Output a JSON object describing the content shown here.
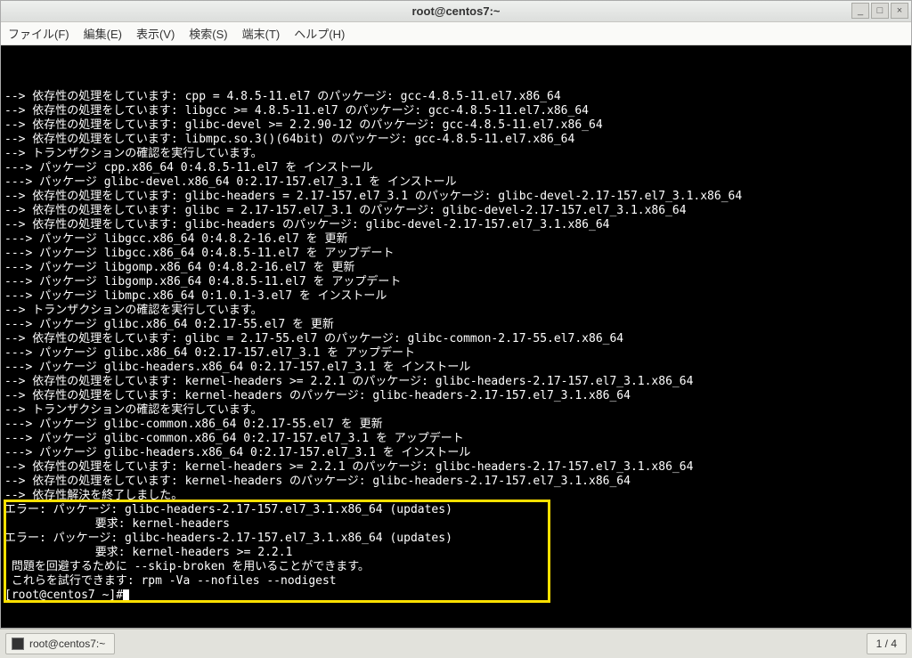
{
  "window": {
    "title": "root@centos7:~"
  },
  "menu": {
    "file": "ファイル(F)",
    "edit": "編集(E)",
    "view": "表示(V)",
    "search": "検索(S)",
    "terminal": "端末(T)",
    "help": "ヘルプ(H)"
  },
  "titlebar_buttons": {
    "min": "_",
    "max": "□",
    "close": "×"
  },
  "terminal_lines": [
    "--> 依存性の処理をしています: cpp = 4.8.5-11.el7 のパッケージ: gcc-4.8.5-11.el7.x86_64",
    "--> 依存性の処理をしています: libgcc >= 4.8.5-11.el7 のパッケージ: gcc-4.8.5-11.el7.x86_64",
    "--> 依存性の処理をしています: glibc-devel >= 2.2.90-12 のパッケージ: gcc-4.8.5-11.el7.x86_64",
    "--> 依存性の処理をしています: libmpc.so.3()(64bit) のパッケージ: gcc-4.8.5-11.el7.x86_64",
    "--> トランザクションの確認を実行しています。",
    "---> パッケージ cpp.x86_64 0:4.8.5-11.el7 を インストール",
    "---> パッケージ glibc-devel.x86_64 0:2.17-157.el7_3.1 を インストール",
    "--> 依存性の処理をしています: glibc-headers = 2.17-157.el7_3.1 のパッケージ: glibc-devel-2.17-157.el7_3.1.x86_64",
    "--> 依存性の処理をしています: glibc = 2.17-157.el7_3.1 のパッケージ: glibc-devel-2.17-157.el7_3.1.x86_64",
    "--> 依存性の処理をしています: glibc-headers のパッケージ: glibc-devel-2.17-157.el7_3.1.x86_64",
    "---> パッケージ libgcc.x86_64 0:4.8.2-16.el7 を 更新",
    "---> パッケージ libgcc.x86_64 0:4.8.5-11.el7 を アップデート",
    "---> パッケージ libgomp.x86_64 0:4.8.2-16.el7 を 更新",
    "---> パッケージ libgomp.x86_64 0:4.8.5-11.el7 を アップデート",
    "---> パッケージ libmpc.x86_64 0:1.0.1-3.el7 を インストール",
    "--> トランザクションの確認を実行しています。",
    "---> パッケージ glibc.x86_64 0:2.17-55.el7 を 更新",
    "--> 依存性の処理をしています: glibc = 2.17-55.el7 のパッケージ: glibc-common-2.17-55.el7.x86_64",
    "---> パッケージ glibc.x86_64 0:2.17-157.el7_3.1 を アップデート",
    "---> パッケージ glibc-headers.x86_64 0:2.17-157.el7_3.1 を インストール",
    "--> 依存性の処理をしています: kernel-headers >= 2.2.1 のパッケージ: glibc-headers-2.17-157.el7_3.1.x86_64",
    "--> 依存性の処理をしています: kernel-headers のパッケージ: glibc-headers-2.17-157.el7_3.1.x86_64",
    "--> トランザクションの確認を実行しています。",
    "---> パッケージ glibc-common.x86_64 0:2.17-55.el7 を 更新",
    "---> パッケージ glibc-common.x86_64 0:2.17-157.el7_3.1 を アップデート",
    "---> パッケージ glibc-headers.x86_64 0:2.17-157.el7_3.1 を インストール",
    "--> 依存性の処理をしています: kernel-headers >= 2.2.1 のパッケージ: glibc-headers-2.17-157.el7_3.1.x86_64",
    "--> 依存性の処理をしています: kernel-headers のパッケージ: glibc-headers-2.17-157.el7_3.1.x86_64",
    "--> 依存性解決を終了しました。",
    "エラー: パッケージ: glibc-headers-2.17-157.el7_3.1.x86_64 (updates)",
    "             要求: kernel-headers",
    "エラー: パッケージ: glibc-headers-2.17-157.el7_3.1.x86_64 (updates)",
    "             要求: kernel-headers >= 2.2.1",
    " 問題を回避するために --skip-broken を用いることができます。",
    " これらを試行できます: rpm -Va --nofiles --nodigest",
    "[root@centos7 ~]#"
  ],
  "taskbar": {
    "task_label": "root@centos7:~",
    "workspace": "1 / 4"
  }
}
